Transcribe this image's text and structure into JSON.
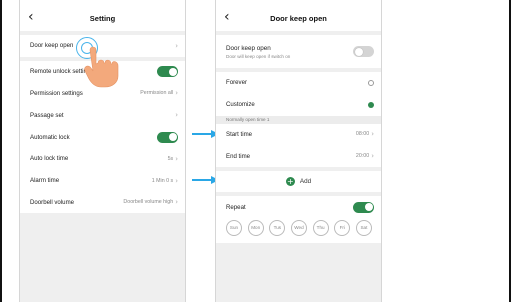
{
  "left_screen": {
    "title": "Setting",
    "door_keep_open": "Door keep open",
    "rows": [
      {
        "label": "Remote unlock settings",
        "toggle": "on"
      },
      {
        "label": "Permission settings",
        "value": "Permission all"
      },
      {
        "label": "Passage set"
      },
      {
        "label": "Automatic lock",
        "toggle": "on"
      },
      {
        "label": "Auto lock time",
        "value": "5s"
      },
      {
        "label": "Alarm time",
        "value": "1 Min 0 s"
      },
      {
        "label": "Doorbell volume",
        "value": "Doorbell volume high"
      }
    ]
  },
  "right_screen": {
    "title": "Door keep open",
    "door_keep_open": {
      "label": "Door keep open",
      "hint": "Door will keep open if switch on",
      "toggle": "off"
    },
    "options": [
      {
        "label": "Forever",
        "selected": false
      },
      {
        "label": "Customize",
        "selected": true
      }
    ],
    "section_label": "Normally open time 1",
    "start_time": {
      "label": "Start time",
      "value": "08:00"
    },
    "end_time": {
      "label": "End time",
      "value": "20:00"
    },
    "add_label": "Add",
    "repeat": {
      "label": "Repeat",
      "toggle": "on"
    },
    "days": [
      "Sun",
      "Mon",
      "Tus",
      "Wed",
      "Thu",
      "Fri",
      "Sat"
    ]
  },
  "colors": {
    "accent_green": "#2e8a4f",
    "arrow_blue": "#2aa7e6"
  },
  "icons": [
    "back-arrow-icon",
    "chevron-right-icon",
    "tap-hand-icon",
    "plus-icon",
    "pointer-arrow-icon"
  ]
}
